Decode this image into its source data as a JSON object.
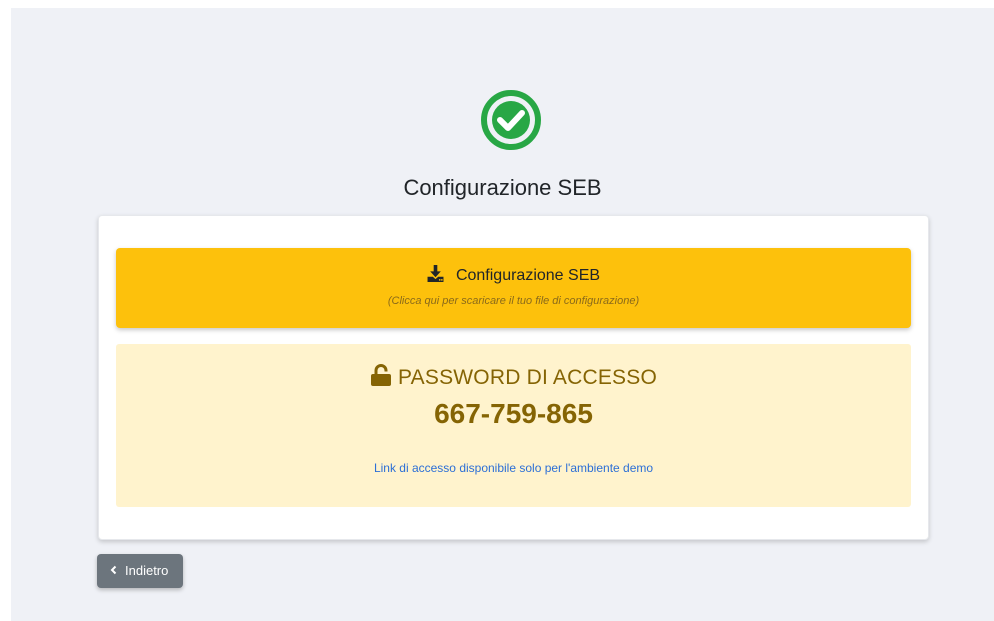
{
  "page": {
    "title": "Configurazione SEB",
    "status_icon": "check-circle-icon",
    "accent_color": "#28a745"
  },
  "download": {
    "label": "Configurazione SEB",
    "hint": "(Clicca qui per scaricare il tuo file di configurazione)",
    "icon": "download-icon",
    "color": "#fdc10c"
  },
  "password": {
    "heading": "PASSWORD DI ACCESSO",
    "value": "667-759-865",
    "icon": "unlock-icon",
    "link_text": "Link di accesso disponibile solo per l'ambiente demo"
  },
  "back_button": {
    "label": "Indietro",
    "icon": "chevron-left-icon"
  }
}
